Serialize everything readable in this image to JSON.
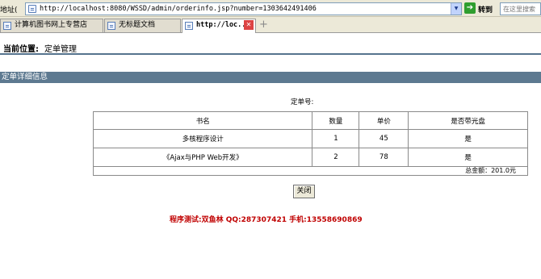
{
  "browser": {
    "address_label": "地址(",
    "url": "http://localhost:8080/WSSD/admin/orderinfo.jsp?number=1303642491406",
    "go_label": "转到",
    "search_placeholder": "在这里搜索",
    "tabs": [
      {
        "label": "计算机图书网上专营店",
        "active": false
      },
      {
        "label": "无标题文档",
        "active": false
      },
      {
        "label": "http://loc...",
        "active": true
      }
    ]
  },
  "page": {
    "position_label": "当前位置:",
    "position_value": "定单管理",
    "section_title": "定单详细信息",
    "order_number_label": "定单号:",
    "table": {
      "headers": [
        "书名",
        "数量",
        "单价",
        "是否带光盘"
      ],
      "rows": [
        [
          "多核程序设计",
          "1",
          "45",
          "是"
        ],
        [
          "《Ajax与PHP Web开发》",
          "2",
          "78",
          "是"
        ]
      ],
      "total": "总金额：201.0元"
    },
    "close_button": "关闭",
    "footer_credit": "程序测试:双鱼林 QQ:287307421 手机:13558690869"
  }
}
